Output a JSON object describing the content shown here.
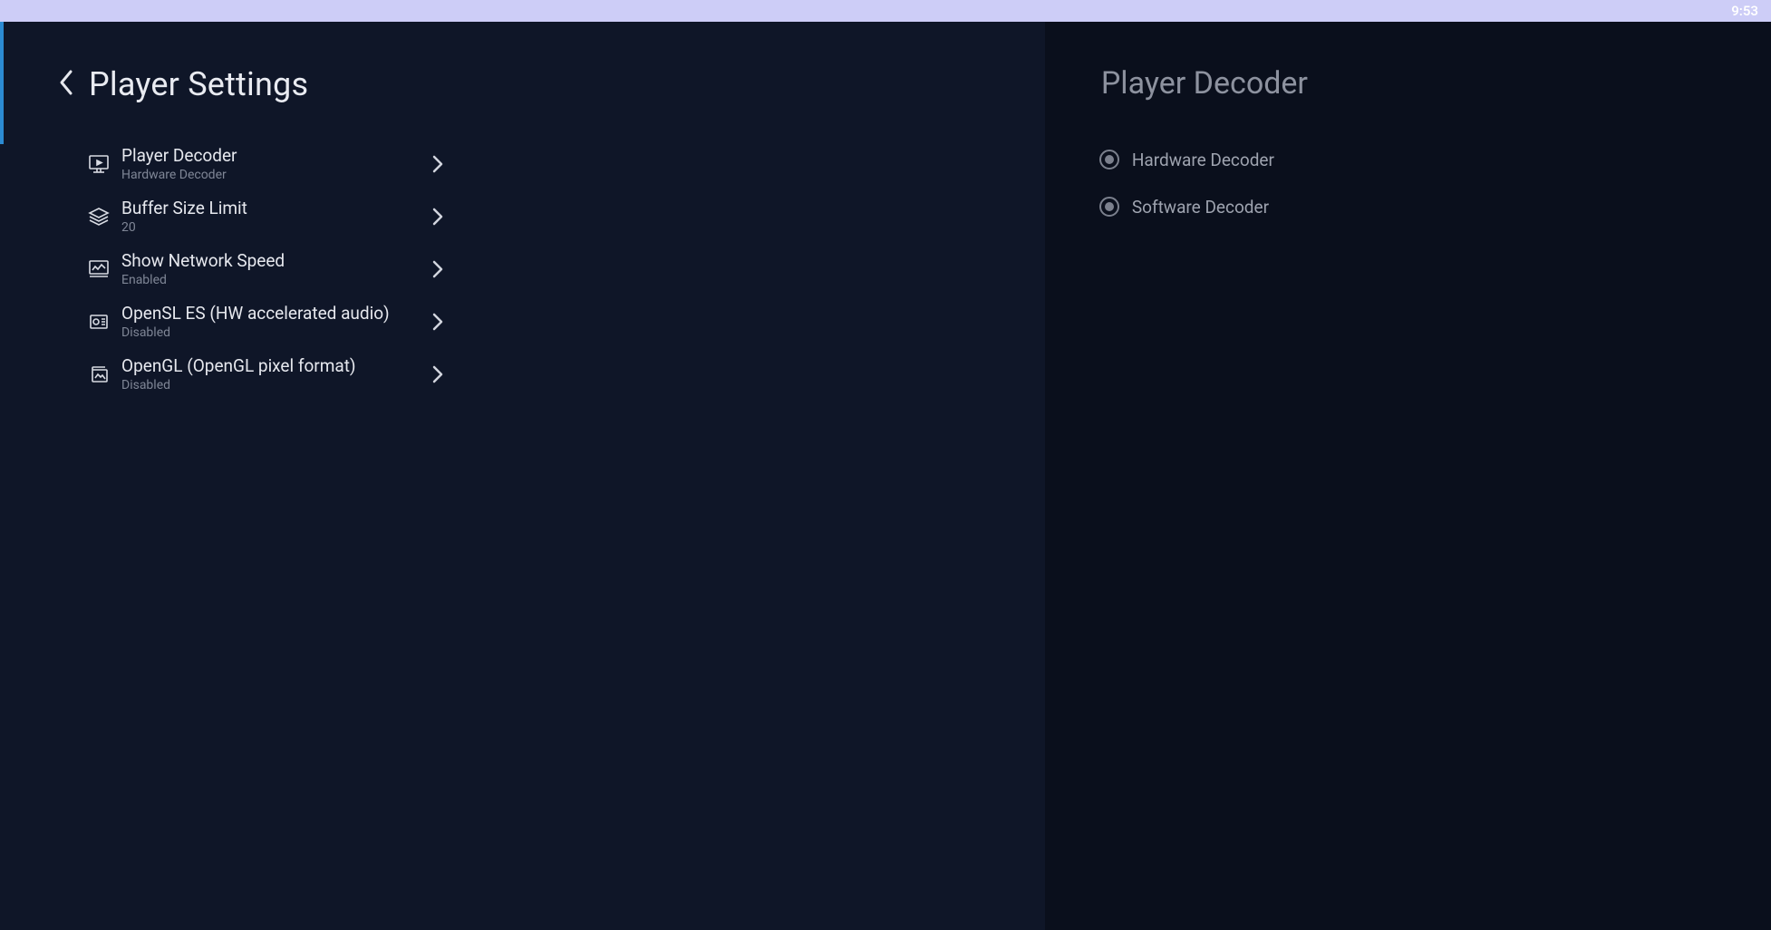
{
  "status_bar": {
    "time": "9:53"
  },
  "left": {
    "title": "Player Settings",
    "settings": [
      {
        "label": "Player Decoder",
        "value": "Hardware Decoder",
        "icon": "monitor-play-icon"
      },
      {
        "label": "Buffer Size Limit",
        "value": "20",
        "icon": "layers-icon"
      },
      {
        "label": "Show Network Speed",
        "value": "Enabled",
        "icon": "network-speed-icon"
      },
      {
        "label": "OpenSL ES (HW accelerated audio)",
        "value": "Disabled",
        "icon": "audio-chip-icon"
      },
      {
        "label": "OpenGL (OpenGL pixel format)",
        "value": "Disabled",
        "icon": "images-icon"
      }
    ]
  },
  "right": {
    "title": "Player Decoder",
    "options": [
      {
        "label": "Hardware Decoder",
        "selected": true
      },
      {
        "label": "Software Decoder",
        "selected": true
      }
    ]
  }
}
